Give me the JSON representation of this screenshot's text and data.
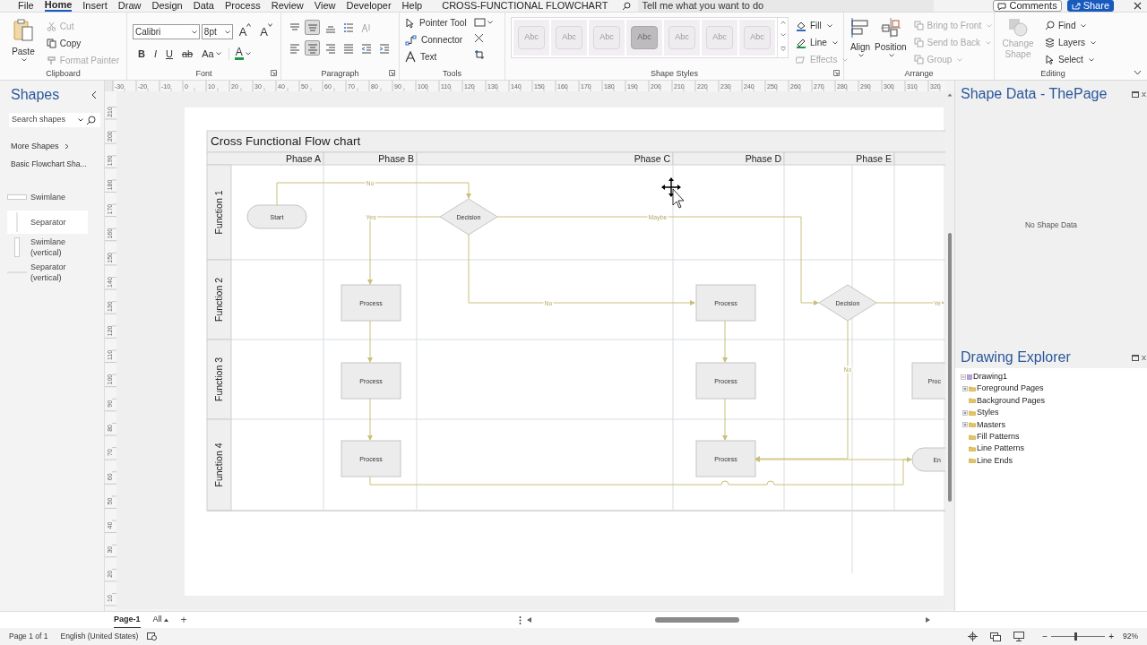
{
  "menu_tabs": [
    {
      "label": "File",
      "selected": false
    },
    {
      "label": "Home",
      "selected": true
    },
    {
      "label": "Insert",
      "selected": false
    },
    {
      "label": "Draw",
      "selected": false
    },
    {
      "label": "Design",
      "selected": false
    },
    {
      "label": "Data",
      "selected": false
    },
    {
      "label": "Process",
      "selected": false
    },
    {
      "label": "Review",
      "selected": false
    },
    {
      "label": "View",
      "selected": false
    },
    {
      "label": "Developer",
      "selected": false
    },
    {
      "label": "Help",
      "selected": false
    }
  ],
  "document_title": "CROSS-FUNCTIONAL FLOWCHART",
  "tell_me": {
    "placeholder": "Tell me what you want to do"
  },
  "header_buttons": [
    "Comments",
    "Share"
  ],
  "ribbon": {
    "clipboard": {
      "label": "Clipboard",
      "paste": "Paste",
      "items": [
        {
          "label": "Cut",
          "disabled": true
        },
        {
          "label": "Copy",
          "disabled": false
        },
        {
          "label": "Format Painter",
          "disabled": true
        }
      ]
    },
    "font": {
      "label": "Font",
      "font_name": "Calibri",
      "font_size": "8pt",
      "size_buttons": [
        "A",
        "A"
      ],
      "format_buttons": [
        {
          "kind": "bold",
          "label": "B"
        },
        {
          "kind": "italic",
          "label": "I"
        },
        {
          "kind": "underline",
          "label": "U"
        },
        {
          "kind": "strike",
          "label": "ab"
        },
        {
          "kind": "case",
          "label": "Aa"
        },
        {
          "kind": "color",
          "label": "A"
        }
      ]
    },
    "paragraph": {
      "label": "Paragraph",
      "rows": [
        [
          {
            "kind": "align-top",
            "selected": false
          },
          {
            "kind": "align-middle",
            "selected": true
          },
          {
            "kind": "align-bottom",
            "selected": false
          },
          {
            "kind": "bullets",
            "selected": false
          },
          {
            "kind": "text-direction",
            "selected": false
          }
        ],
        [
          {
            "kind": "align-left",
            "selected": false
          },
          {
            "kind": "align-center",
            "selected": true
          },
          {
            "kind": "align-right",
            "selected": false
          },
          {
            "kind": "justify",
            "selected": false
          },
          {
            "kind": "outdent",
            "selected": false
          },
          {
            "kind": "indent",
            "selected": false
          }
        ]
      ]
    },
    "tools": {
      "label": "Tools",
      "items": [
        {
          "kind": "pointer",
          "label": "Pointer Tool"
        },
        {
          "kind": "connector",
          "label": "Connector"
        },
        {
          "kind": "text",
          "label": "Text"
        }
      ]
    },
    "shape_styles": {
      "label": "Shape Styles",
      "swatches": [
        {
          "label": "Abc",
          "selected": false
        },
        {
          "label": "Abc",
          "selected": false
        },
        {
          "label": "Abc",
          "selected": false
        },
        {
          "label": "Abc",
          "selected": true
        },
        {
          "label": "Abc",
          "selected": false
        },
        {
          "label": "Abc",
          "selected": false
        },
        {
          "label": "Abc",
          "selected": false
        }
      ],
      "items": [
        {
          "kind": "fill",
          "label": "Fill",
          "disabled": false
        },
        {
          "kind": "line",
          "label": "Line",
          "disabled": false
        },
        {
          "kind": "effects",
          "label": "Effects",
          "disabled": true
        }
      ]
    },
    "arrange": {
      "label": "Arrange",
      "big": [
        {
          "kind": "align",
          "label": "Align"
        },
        {
          "kind": "position",
          "label": "Position"
        }
      ],
      "items": [
        {
          "label": "Bring to Front",
          "disabled": true
        },
        {
          "label": "Send to Back",
          "disabled": true
        },
        {
          "label": "Group",
          "disabled": true
        }
      ]
    },
    "editing": {
      "label": "Editing",
      "change_shape": {
        "label": "Change Shape",
        "disabled": true
      },
      "items": [
        {
          "kind": "find",
          "label": "Find"
        },
        {
          "kind": "layers",
          "label": "Layers"
        },
        {
          "kind": "select",
          "label": "Select"
        }
      ]
    }
  },
  "shapes_panel": {
    "title": "Shapes",
    "search": {
      "placeholder": "Search shapes"
    },
    "more_shapes": "More Shapes",
    "stencil": "Basic Flowchart Sha...",
    "items": [
      {
        "kind": "swimlane",
        "label": "Swimlane",
        "selected": false
      },
      {
        "kind": "separator",
        "label": "Separator",
        "selected": true
      },
      {
        "kind": "swimlane-vertical",
        "label": "Swimlane (vertical)",
        "selected": false
      },
      {
        "kind": "separator-vertical",
        "label": "Separator (vertical)",
        "selected": false
      }
    ]
  },
  "ruler": {
    "horizontal": [
      "-30",
      "-20",
      "-10",
      "0",
      "10",
      "20",
      "30",
      "40",
      "50",
      "60",
      "70",
      "80",
      "90",
      "100",
      "110",
      "120",
      "130",
      "140",
      "150",
      "160",
      "170",
      "180",
      "190",
      "200",
      "210",
      "220",
      "230",
      "240",
      "250",
      "260",
      "270",
      "280",
      "290",
      "300",
      "310",
      "320"
    ],
    "vertical": [
      "210",
      "200",
      "190",
      "180",
      "170",
      "160",
      "150",
      "140",
      "130",
      "120",
      "110",
      "100",
      "90",
      "80",
      "70",
      "60",
      "50",
      "40",
      "30",
      "20",
      "10"
    ]
  },
  "diagram": {
    "title": "Cross Functional Flow chart",
    "phases": [
      "Phase A",
      "Phase B",
      "Phase C",
      "Phase D",
      "Phase E"
    ],
    "lanes": [
      "Function 1",
      "Function 2",
      "Function 3",
      "Function 4"
    ],
    "shapes": [
      {
        "kind": "terminator",
        "label": "Start"
      },
      {
        "kind": "decision",
        "label": "Decision"
      },
      {
        "kind": "process",
        "label": "Process"
      },
      {
        "kind": "process",
        "label": "Process"
      },
      {
        "kind": "process",
        "label": "Process"
      },
      {
        "kind": "process",
        "label": "Process"
      },
      {
        "kind": "process",
        "label": "Process"
      },
      {
        "kind": "process",
        "label": "Process"
      },
      {
        "kind": "decision",
        "label": "Decision"
      },
      {
        "kind": "process",
        "label": "Proc"
      },
      {
        "kind": "terminator",
        "label": "En"
      }
    ],
    "connector_labels": [
      "No",
      "Yes",
      "Maybe",
      "No",
      "Ye",
      "No"
    ]
  },
  "shape_data_panel": {
    "title": "Shape Data - ThePage",
    "message": "No Shape Data"
  },
  "drawing_explorer": {
    "title": "Drawing Explorer",
    "tree": [
      {
        "label": "Drawing1",
        "expandable": true,
        "expanded": true,
        "children": [
          {
            "label": "Foreground Pages",
            "expandable": true,
            "expanded": false
          },
          {
            "label": "Background Pages",
            "expandable": false
          },
          {
            "label": "Styles",
            "expandable": true,
            "expanded": false
          },
          {
            "label": "Masters",
            "expandable": true,
            "expanded": false
          },
          {
            "label": "Fill Patterns",
            "expandable": false
          },
          {
            "label": "Line Patterns",
            "expandable": false
          },
          {
            "label": "Line Ends",
            "expandable": false
          }
        ]
      }
    ]
  },
  "page_tabs": [
    {
      "label": "Page-1",
      "selected": true
    }
  ],
  "page_filter": "All",
  "add_page": "+",
  "status_bar": {
    "page": "Page 1 of 1",
    "language": "English (United States)",
    "zoom_out": "−",
    "zoom_in": "+",
    "zoom": {
      "level": 0.45
    },
    "zoom_value": "92%"
  }
}
